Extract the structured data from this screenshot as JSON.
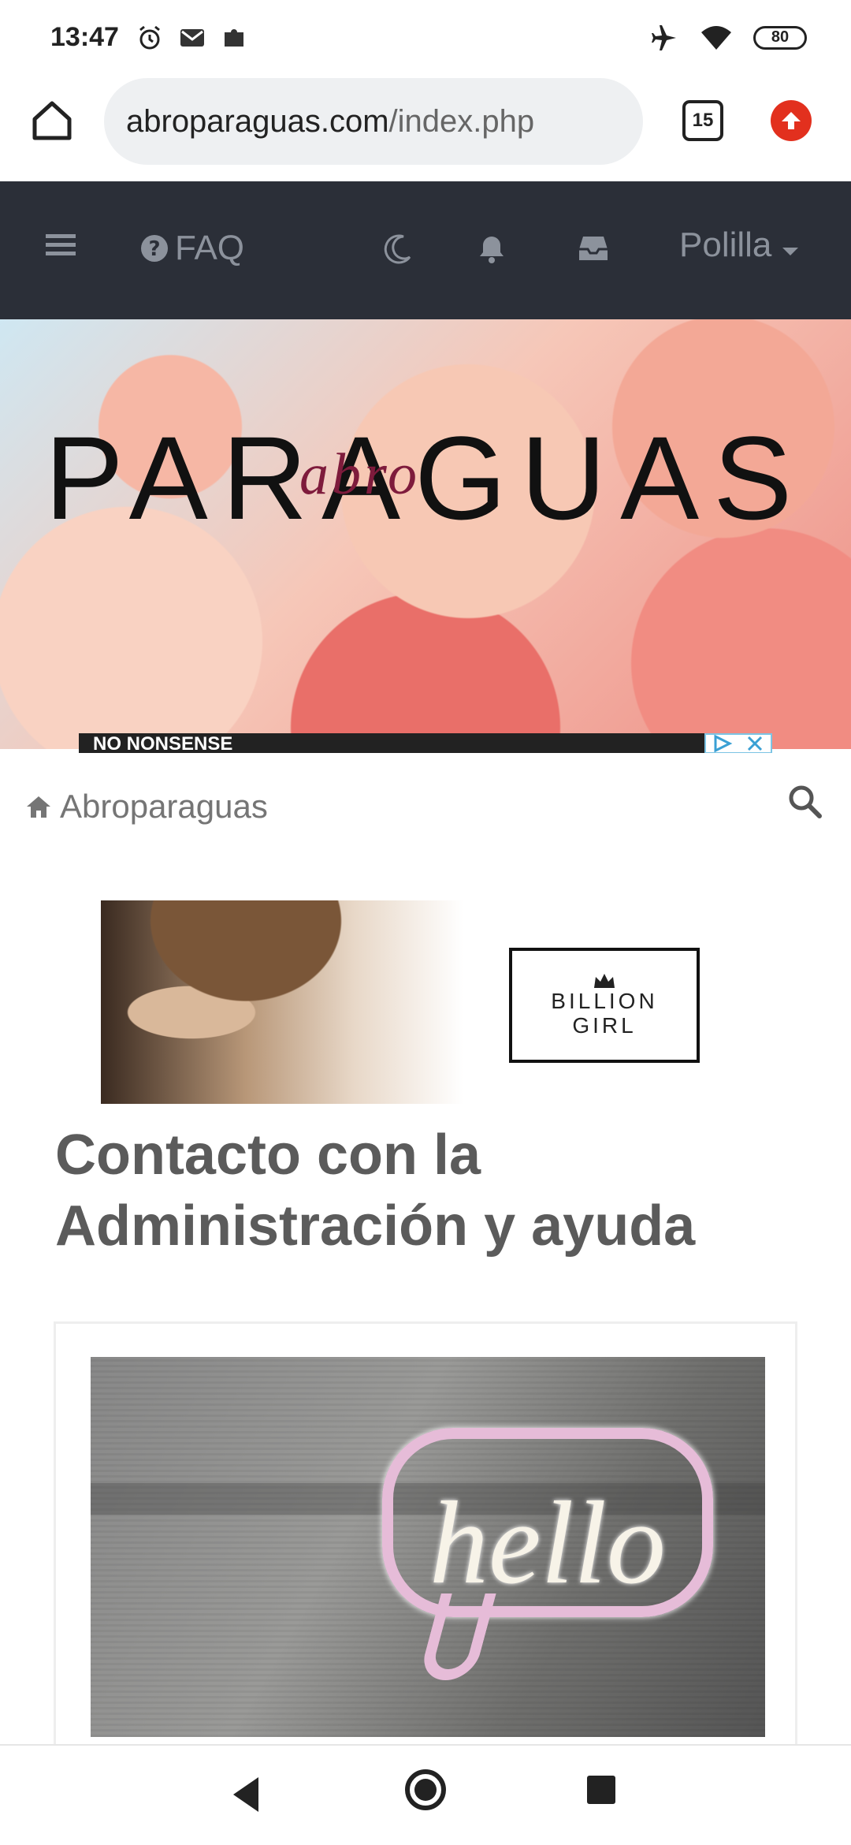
{
  "status_bar": {
    "time": "13:47",
    "battery": "80",
    "icons_left": [
      "alarm-icon",
      "gmail-icon",
      "puzzle-icon"
    ],
    "icons_right": [
      "airplane-icon",
      "wifi-icon",
      "battery-icon"
    ]
  },
  "browser": {
    "url_domain": "abroparaguas.com",
    "url_path": "/index.php",
    "tab_count": "15",
    "update_icon": "arrow-up-icon",
    "accent": "#e2301e"
  },
  "navbar": {
    "menu_icon": "hamburger-icon",
    "faq_label": "FAQ",
    "theme_icon": "moon-icon",
    "notifications_icon": "bell-icon",
    "inbox_icon": "inbox-icon",
    "user_label": "Polilla",
    "bg_color": "#2b2f38"
  },
  "banner": {
    "title": "PARAGUAS",
    "script_text": "abro",
    "ad_strip_text": "NO NONSENSE"
  },
  "breadcrumb": {
    "label": "Abroparaguas"
  },
  "ad": {
    "brand_line1": "BILLION",
    "brand_line2": "GIRL"
  },
  "page": {
    "title": "Contacto con la Administración y ayuda"
  },
  "card": {
    "image_text": "hello"
  }
}
